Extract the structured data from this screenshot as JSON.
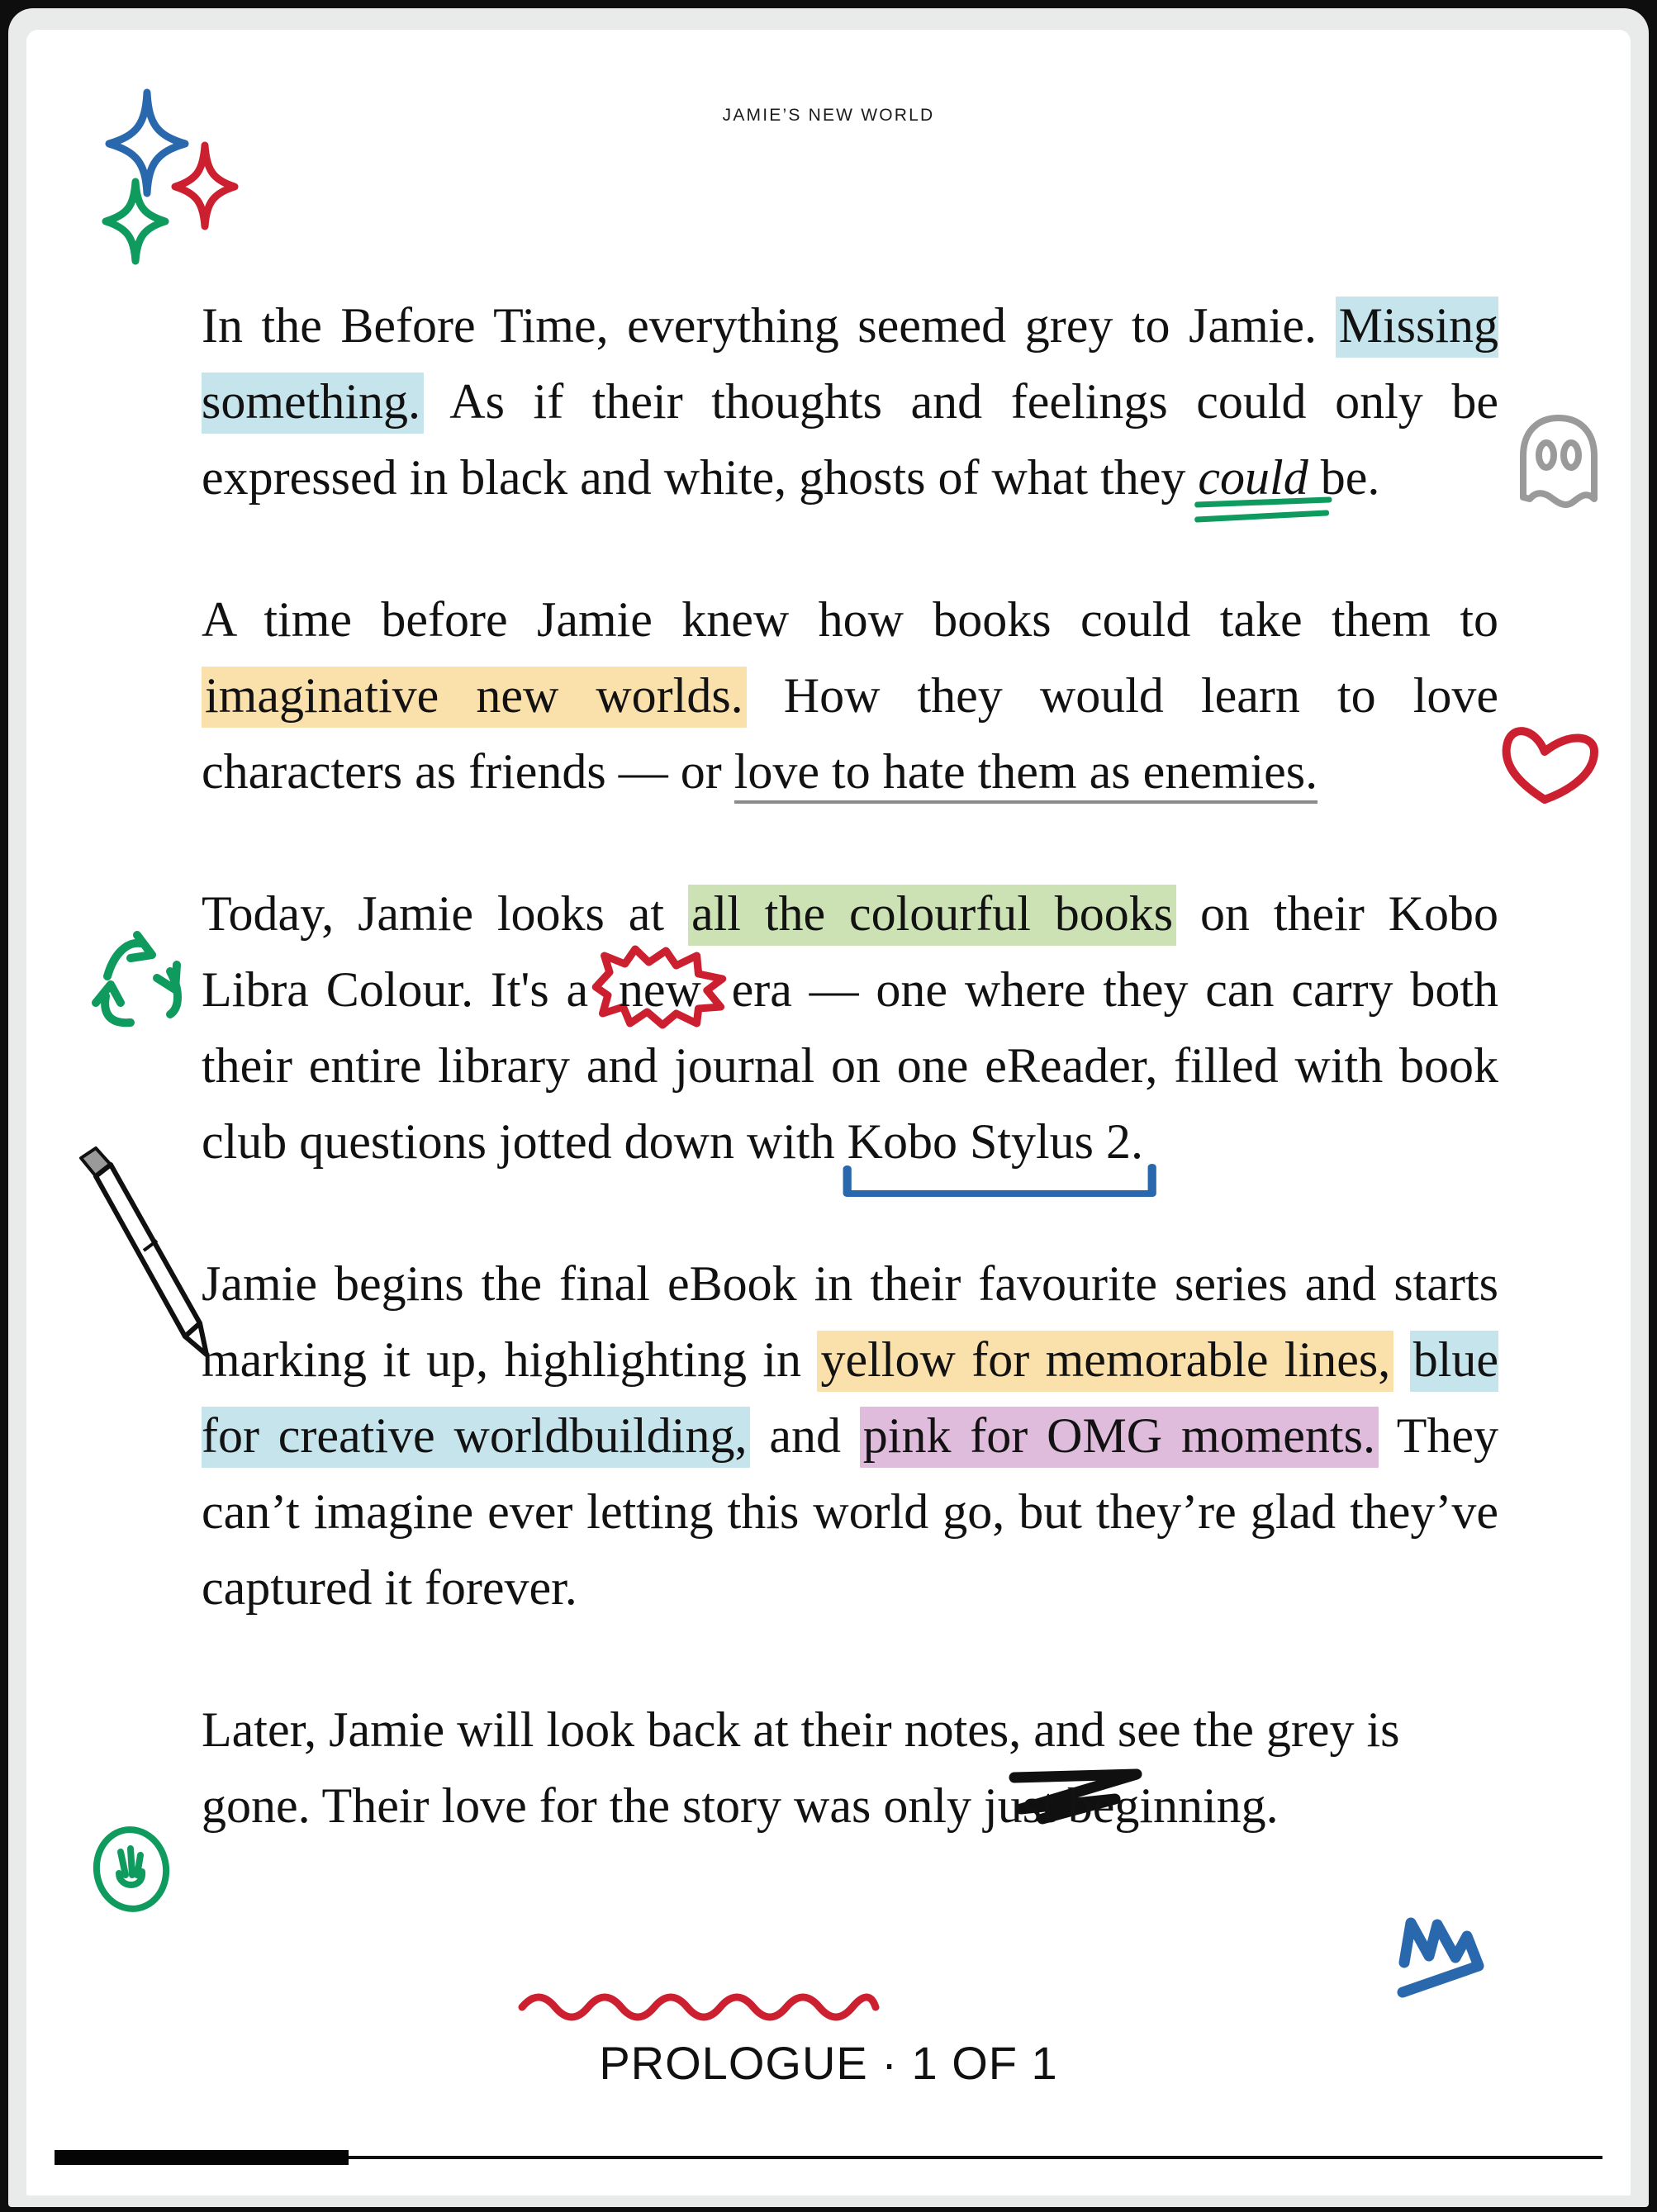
{
  "device": {
    "bezel_color": "#e9eaea",
    "page_color": "#ffffff",
    "frame_color": "#0e0e0e"
  },
  "header": {
    "running_title": "JAMIE’S NEW WORLD"
  },
  "footer": {
    "label": "PROLOGUE · 1 OF 1"
  },
  "progress": {
    "percent": 19
  },
  "colors": {
    "highlight_blue": "#c5e4ec",
    "highlight_yellow": "#fae0ab",
    "highlight_green": "#cde2b4",
    "highlight_pink": "#e0bcdc",
    "ink_blue": "#2a68ad",
    "ink_red": "#cc2030",
    "ink_green": "#0f9a5e",
    "ink_grey": "#8b8b8b",
    "ink_black": "#101010",
    "text": "#121212"
  },
  "paragraphs": [
    {
      "id": "p1",
      "runs": [
        {
          "text": "In the Before Time, everything seemed grey to Jamie. ",
          "style": "plain"
        },
        {
          "text": "Missing something.",
          "style": "highlight-blue"
        },
        {
          "text": " As if their thoughts and feelings could only be expressed in black and white, ghosts of what they ",
          "style": "plain"
        },
        {
          "text": "could",
          "style": "italic-double-underline-green"
        },
        {
          "text": " be.",
          "style": "plain"
        }
      ]
    },
    {
      "id": "p2",
      "runs": [
        {
          "text": "A time before Jamie knew how books could take them to ",
          "style": "plain"
        },
        {
          "text": "imaginative new worlds.",
          "style": "highlight-yellow"
        },
        {
          "text": " How they would learn to love characters as friends — or ",
          "style": "plain"
        },
        {
          "text": "love to hate them as enemies.",
          "style": "underline-grey"
        }
      ]
    },
    {
      "id": "p3",
      "runs": [
        {
          "text": "Today, Jamie looks at ",
          "style": "plain"
        },
        {
          "text": "all the colourful books",
          "style": "highlight-green"
        },
        {
          "text": " on their Kobo Libra Colour. It's a ",
          "style": "plain"
        },
        {
          "text": "new",
          "style": "starburst-red"
        },
        {
          "text": " era — one where they can carry both their entire library and journal on one eReader, filled with book club questions jotted down with ",
          "style": "plain"
        },
        {
          "text": "Kobo Stylus 2.",
          "style": "bracket-underline-blue"
        }
      ]
    },
    {
      "id": "p4",
      "runs": [
        {
          "text": "Jamie begins the final eBook in their favourite series and starts marking it up, highlighting in ",
          "style": "plain"
        },
        {
          "text": "yellow for memorable lines,",
          "style": "highlight-yellow"
        },
        {
          "text": " ",
          "style": "plain"
        },
        {
          "text": "blue for creative worldbuilding,",
          "style": "highlight-blue"
        },
        {
          "text": " and ",
          "style": "plain"
        },
        {
          "text": "pink for OMG moments.",
          "style": "highlight-pink"
        },
        {
          "text": " They can’t imagine ever letting this world go, but they’re glad they’ve captured it forever.",
          "style": "plain"
        }
      ]
    },
    {
      "id": "p5",
      "runs": [
        {
          "text": "Later, Jamie will look back at their notes, and see the grey is gone. Their love for the story was only just beginning.",
          "style": "wavy-underline-red"
        }
      ]
    }
  ],
  "decorations": [
    {
      "name": "sparkle-blue-icon",
      "color": "#2a68ad"
    },
    {
      "name": "sparkle-red-icon",
      "color": "#cc2030"
    },
    {
      "name": "sparkle-green-icon",
      "color": "#0f9a5e"
    },
    {
      "name": "ghost-icon",
      "color": "#9a9a9a"
    },
    {
      "name": "heart-icon",
      "color": "#cc2030"
    },
    {
      "name": "recycle-icon",
      "color": "#0f9a5e"
    },
    {
      "name": "pencil-icon",
      "color": "#101010"
    },
    {
      "name": "scribble-black-icon",
      "color": "#101010"
    },
    {
      "name": "smiley-hand-icon",
      "color": "#0f9a5e"
    },
    {
      "name": "zigzag-blue-icon",
      "color": "#2a68ad"
    }
  ]
}
